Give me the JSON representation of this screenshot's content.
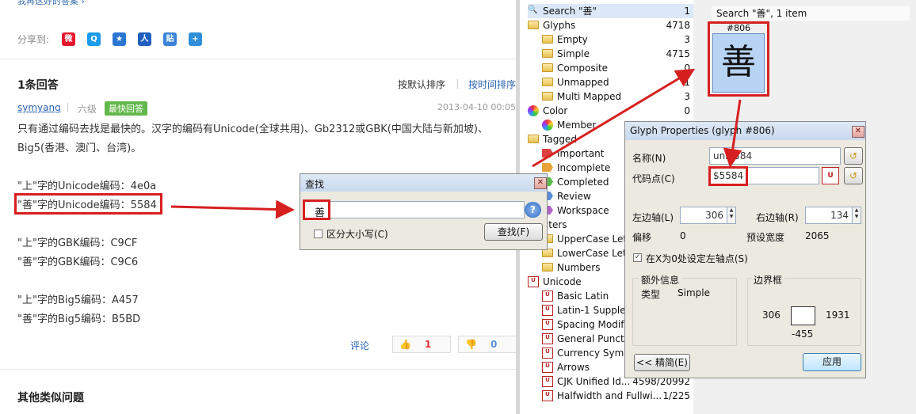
{
  "qa": {
    "top_link": "我再这好的答案 ›",
    "share_label": "分享到:",
    "share_icons": [
      {
        "name": "weibo-share-icon",
        "color": "#e6162d",
        "glyph": "微"
      },
      {
        "name": "qzone-share-icon",
        "color": "#1b9be9",
        "glyph": "Q"
      },
      {
        "name": "qq-share-icon",
        "color": "#2a76d3",
        "glyph": "★"
      },
      {
        "name": "renren-share-icon",
        "color": "#1f5fbf",
        "glyph": "人"
      },
      {
        "name": "tieba-share-icon",
        "color": "#3b83d8",
        "glyph": "贴"
      },
      {
        "name": "more-share-icon",
        "color": "#2f8fdb",
        "glyph": "+"
      }
    ],
    "answers_title": "1条回答",
    "sort_default": "按默认排序",
    "sort_time": "按时间排序",
    "username": "symyang",
    "rank": "六级",
    "badge": "最快回答",
    "date": "2013-04-10 00:05",
    "lines": [
      "只有通过编码去找是最快的。汉字的编码有Unicode(全球共用)、Gb2312或GBK(中国大陆与新加坡)、",
      "Big5(香港、澳门、台湾)。",
      "\"上\"字的Unicode编码：4e0a",
      "\"善\"字的Unicode编码：5584",
      "\"上\"字的GBK编码：C9CF",
      "\"善\"字的GBK编码：C9C6",
      "\"上\"字的Big5编码：A457",
      "\"善\"字的Big5编码：B5BD"
    ],
    "comment": "评论",
    "upvotes": "1",
    "downvotes": "0",
    "other_title": "其他类似问题"
  },
  "find": {
    "title": "查找",
    "value": "善",
    "case_label": "区分大小写(C)",
    "find_button": "查找(F)",
    "help_icon": "?"
  },
  "tree": {
    "rows": [
      {
        "label": "Search \"善\"",
        "count": "1",
        "icon": "search",
        "indent": 0
      },
      {
        "label": "Glyphs",
        "count": "4718",
        "icon": "folder",
        "indent": 0
      },
      {
        "label": "Empty",
        "count": "3",
        "icon": "folder",
        "indent": 1
      },
      {
        "label": "Simple",
        "count": "4715",
        "icon": "folder",
        "indent": 1
      },
      {
        "label": "Composite",
        "count": "0",
        "icon": "folder",
        "indent": 1
      },
      {
        "label": "Unmapped",
        "count": "1",
        "icon": "folder",
        "indent": 1
      },
      {
        "label": "Multi Mapped",
        "count": "3",
        "icon": "folder",
        "indent": 1
      },
      {
        "label": "Color",
        "count": "0",
        "icon": "color",
        "indent": 0
      },
      {
        "label": "Member",
        "count": "",
        "icon": "color",
        "indent": 1
      },
      {
        "label": "Tagged",
        "count": "",
        "icon": "folder",
        "indent": 0
      },
      {
        "label": "Important",
        "count": "",
        "icon": "tag",
        "tag": "#e04040",
        "indent": 1
      },
      {
        "label": "Incomplete",
        "count": "",
        "icon": "tag",
        "tag": "#e8a23a",
        "indent": 1
      },
      {
        "label": "Completed",
        "count": "",
        "icon": "tag",
        "tag": "#5bbd4a",
        "indent": 1
      },
      {
        "label": "Review",
        "count": "",
        "icon": "tag",
        "tag": "#5a8fd6",
        "indent": 1
      },
      {
        "label": "Workspace",
        "count": "",
        "icon": "tag",
        "tag": "#b066c8",
        "indent": 1
      },
      {
        "label": "aracters",
        "count": "",
        "icon": "none",
        "indent": 0
      },
      {
        "label": "UpperCase Lett",
        "count": "",
        "icon": "folder",
        "indent": 1
      },
      {
        "label": "LowerCase Lett",
        "count": "",
        "icon": "folder",
        "indent": 1
      },
      {
        "label": "Numbers",
        "count": "",
        "icon": "folder",
        "indent": 1
      },
      {
        "label": "Unicode",
        "count": "",
        "icon": "uni",
        "indent": 0
      },
      {
        "label": "Basic Latin",
        "count": "",
        "icon": "uni",
        "indent": 1
      },
      {
        "label": "Latin-1 Supplem",
        "count": "",
        "icon": "uni",
        "indent": 1
      },
      {
        "label": "Spacing Modif",
        "count": "",
        "icon": "uni",
        "indent": 1
      },
      {
        "label": "General Punctu",
        "count": "",
        "icon": "uni",
        "indent": 1
      },
      {
        "label": "Currency Symb",
        "count": "",
        "icon": "uni",
        "indent": 1
      },
      {
        "label": "Arrows",
        "count": "",
        "icon": "uni",
        "indent": 1
      },
      {
        "label": "CJK Unified Id...",
        "count": "4598/20992",
        "icon": "uni",
        "indent": 1
      },
      {
        "label": "Halfwidth and Fullwi...",
        "count": "1/225",
        "icon": "uni",
        "indent": 1
      }
    ]
  },
  "glyphs": {
    "header": "Search \"善\", 1 item",
    "cell_number": "#806",
    "cell_char": "善"
  },
  "props": {
    "title": "Glyph Properties (glyph #806)",
    "name_label": "名称(N)",
    "name_value": "uni5584",
    "code_label": "代码点(C)",
    "code_value": "$5584",
    "lsb_label": "左边轴(L)",
    "lsb_value": "306",
    "rsb_label": "右边轴(R)",
    "rsb_value": "134",
    "offset_label": "偏移",
    "offset_value": "0",
    "width_label": "预设宽度",
    "width_value": "2065",
    "origin_label": "在X为0处设定左轴点(S)",
    "extra_title": "额外信息",
    "type_label": "类型",
    "type_value": "Simple",
    "bbox_title": "边界框",
    "bbox_left": "306",
    "bbox_right": "1931",
    "bbox_bottom": "-455",
    "compact_button": "<< 精简(E)",
    "apply_button": "应用"
  }
}
